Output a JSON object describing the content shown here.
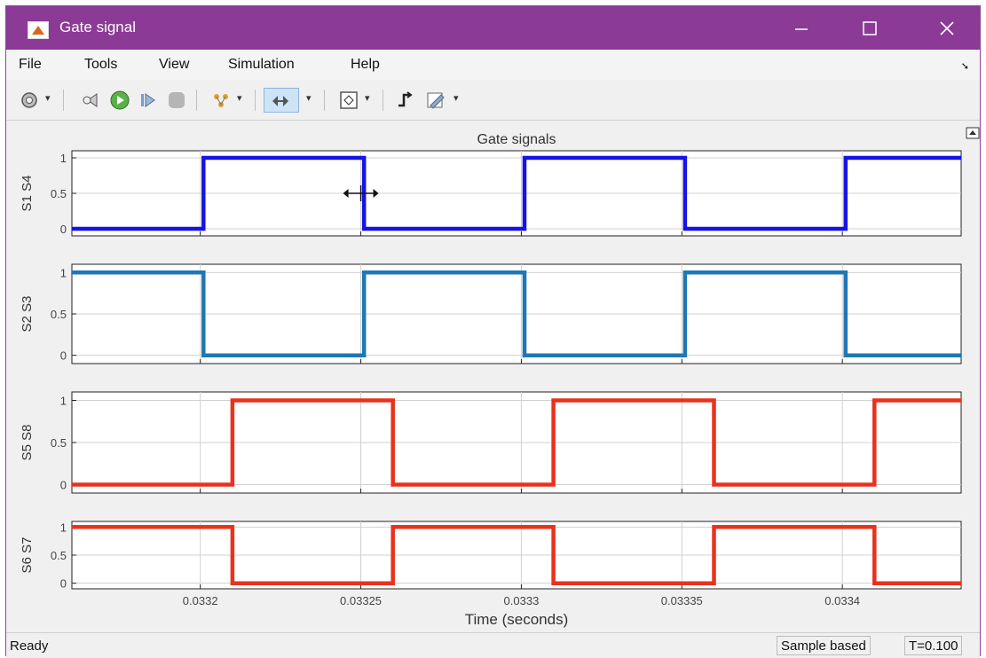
{
  "window": {
    "title": "Gate signal"
  },
  "menu": [
    "File",
    "Tools",
    "View",
    "Simulation",
    "Help"
  ],
  "toolbar_icons": [
    "settings-icon",
    "step-back-icon",
    "run-icon",
    "step-forward-icon",
    "stop-icon",
    "signal-selector-icon",
    "zoom-icon",
    "fit-view-icon",
    "trigger-icon",
    "style-icon"
  ],
  "status": {
    "left": "Ready",
    "mode": "Sample based",
    "time": "T=0.100"
  },
  "chart_data": [
    {
      "type": "line",
      "title": "Gate signals",
      "ylabel": "S1 S4",
      "color": "#1414e6",
      "x": [
        0.03316,
        0.033201,
        0.033201,
        0.033251,
        0.033251,
        0.033301,
        0.033301,
        0.033351,
        0.033351,
        0.033401,
        0.033401,
        0.033437
      ],
      "y": [
        0,
        0,
        1,
        1,
        0,
        0,
        1,
        1,
        0,
        0,
        1,
        1
      ],
      "yticks": [
        "0",
        "0.5",
        "1"
      ],
      "ylim": [
        -0.1,
        1.1
      ]
    },
    {
      "type": "line",
      "ylabel": "S2 S3",
      "color": "#1f77b4",
      "x": [
        0.03316,
        0.033201,
        0.033201,
        0.033251,
        0.033251,
        0.033301,
        0.033301,
        0.033351,
        0.033351,
        0.033401,
        0.033401,
        0.033437
      ],
      "y": [
        1,
        1,
        0,
        0,
        1,
        1,
        0,
        0,
        1,
        1,
        0,
        0
      ],
      "yticks": [
        "0",
        "0.5",
        "1"
      ],
      "ylim": [
        -0.1,
        1.1
      ]
    },
    {
      "type": "line",
      "ylabel": "S5 S8",
      "color": "#e8321e",
      "x": [
        0.03316,
        0.03321,
        0.03321,
        0.03326,
        0.03326,
        0.03331,
        0.03331,
        0.03336,
        0.03336,
        0.03341,
        0.03341,
        0.033437
      ],
      "y": [
        0,
        0,
        1,
        1,
        0,
        0,
        1,
        1,
        0,
        0,
        1,
        1
      ],
      "yticks": [
        "0",
        "0.5",
        "1"
      ],
      "ylim": [
        -0.1,
        1.1
      ]
    },
    {
      "type": "line",
      "ylabel": "S6 S7",
      "color": "#e8321e",
      "x": [
        0.03316,
        0.03321,
        0.03321,
        0.03326,
        0.03326,
        0.03331,
        0.03331,
        0.03336,
        0.03336,
        0.03341,
        0.03341,
        0.033437
      ],
      "y": [
        1,
        1,
        0,
        0,
        1,
        1,
        0,
        0,
        1,
        1,
        0,
        0
      ],
      "yticks": [
        "0",
        "0.5",
        "1"
      ],
      "ylim": [
        -0.1,
        1.1
      ],
      "xticks": [
        "0.0332",
        "0.03325",
        "0.0333",
        "0.03335",
        "0.0334"
      ],
      "xlabel": "Time (seconds)"
    }
  ],
  "x_axis": {
    "xlim": [
      0.03316,
      0.033437
    ],
    "tick_values": [
      0.0332,
      0.03325,
      0.0333,
      0.03335,
      0.0334
    ]
  }
}
